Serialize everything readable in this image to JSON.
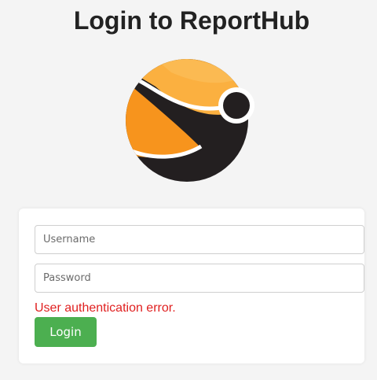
{
  "page": {
    "title": "Login to ReportHub"
  },
  "logo": {
    "icon": "reporthub-logo-icon",
    "colors": {
      "orange_light": "#fbb040",
      "orange_dark": "#f7941d",
      "dark": "#231f20"
    }
  },
  "form": {
    "username_placeholder": "Username",
    "username_value": "",
    "password_placeholder": "Password",
    "password_value": "",
    "error_message": "User authentication error.",
    "login_label": "Login"
  },
  "colors": {
    "background": "#f4f4f4",
    "error": "#e02020",
    "button": "#4caf50"
  }
}
